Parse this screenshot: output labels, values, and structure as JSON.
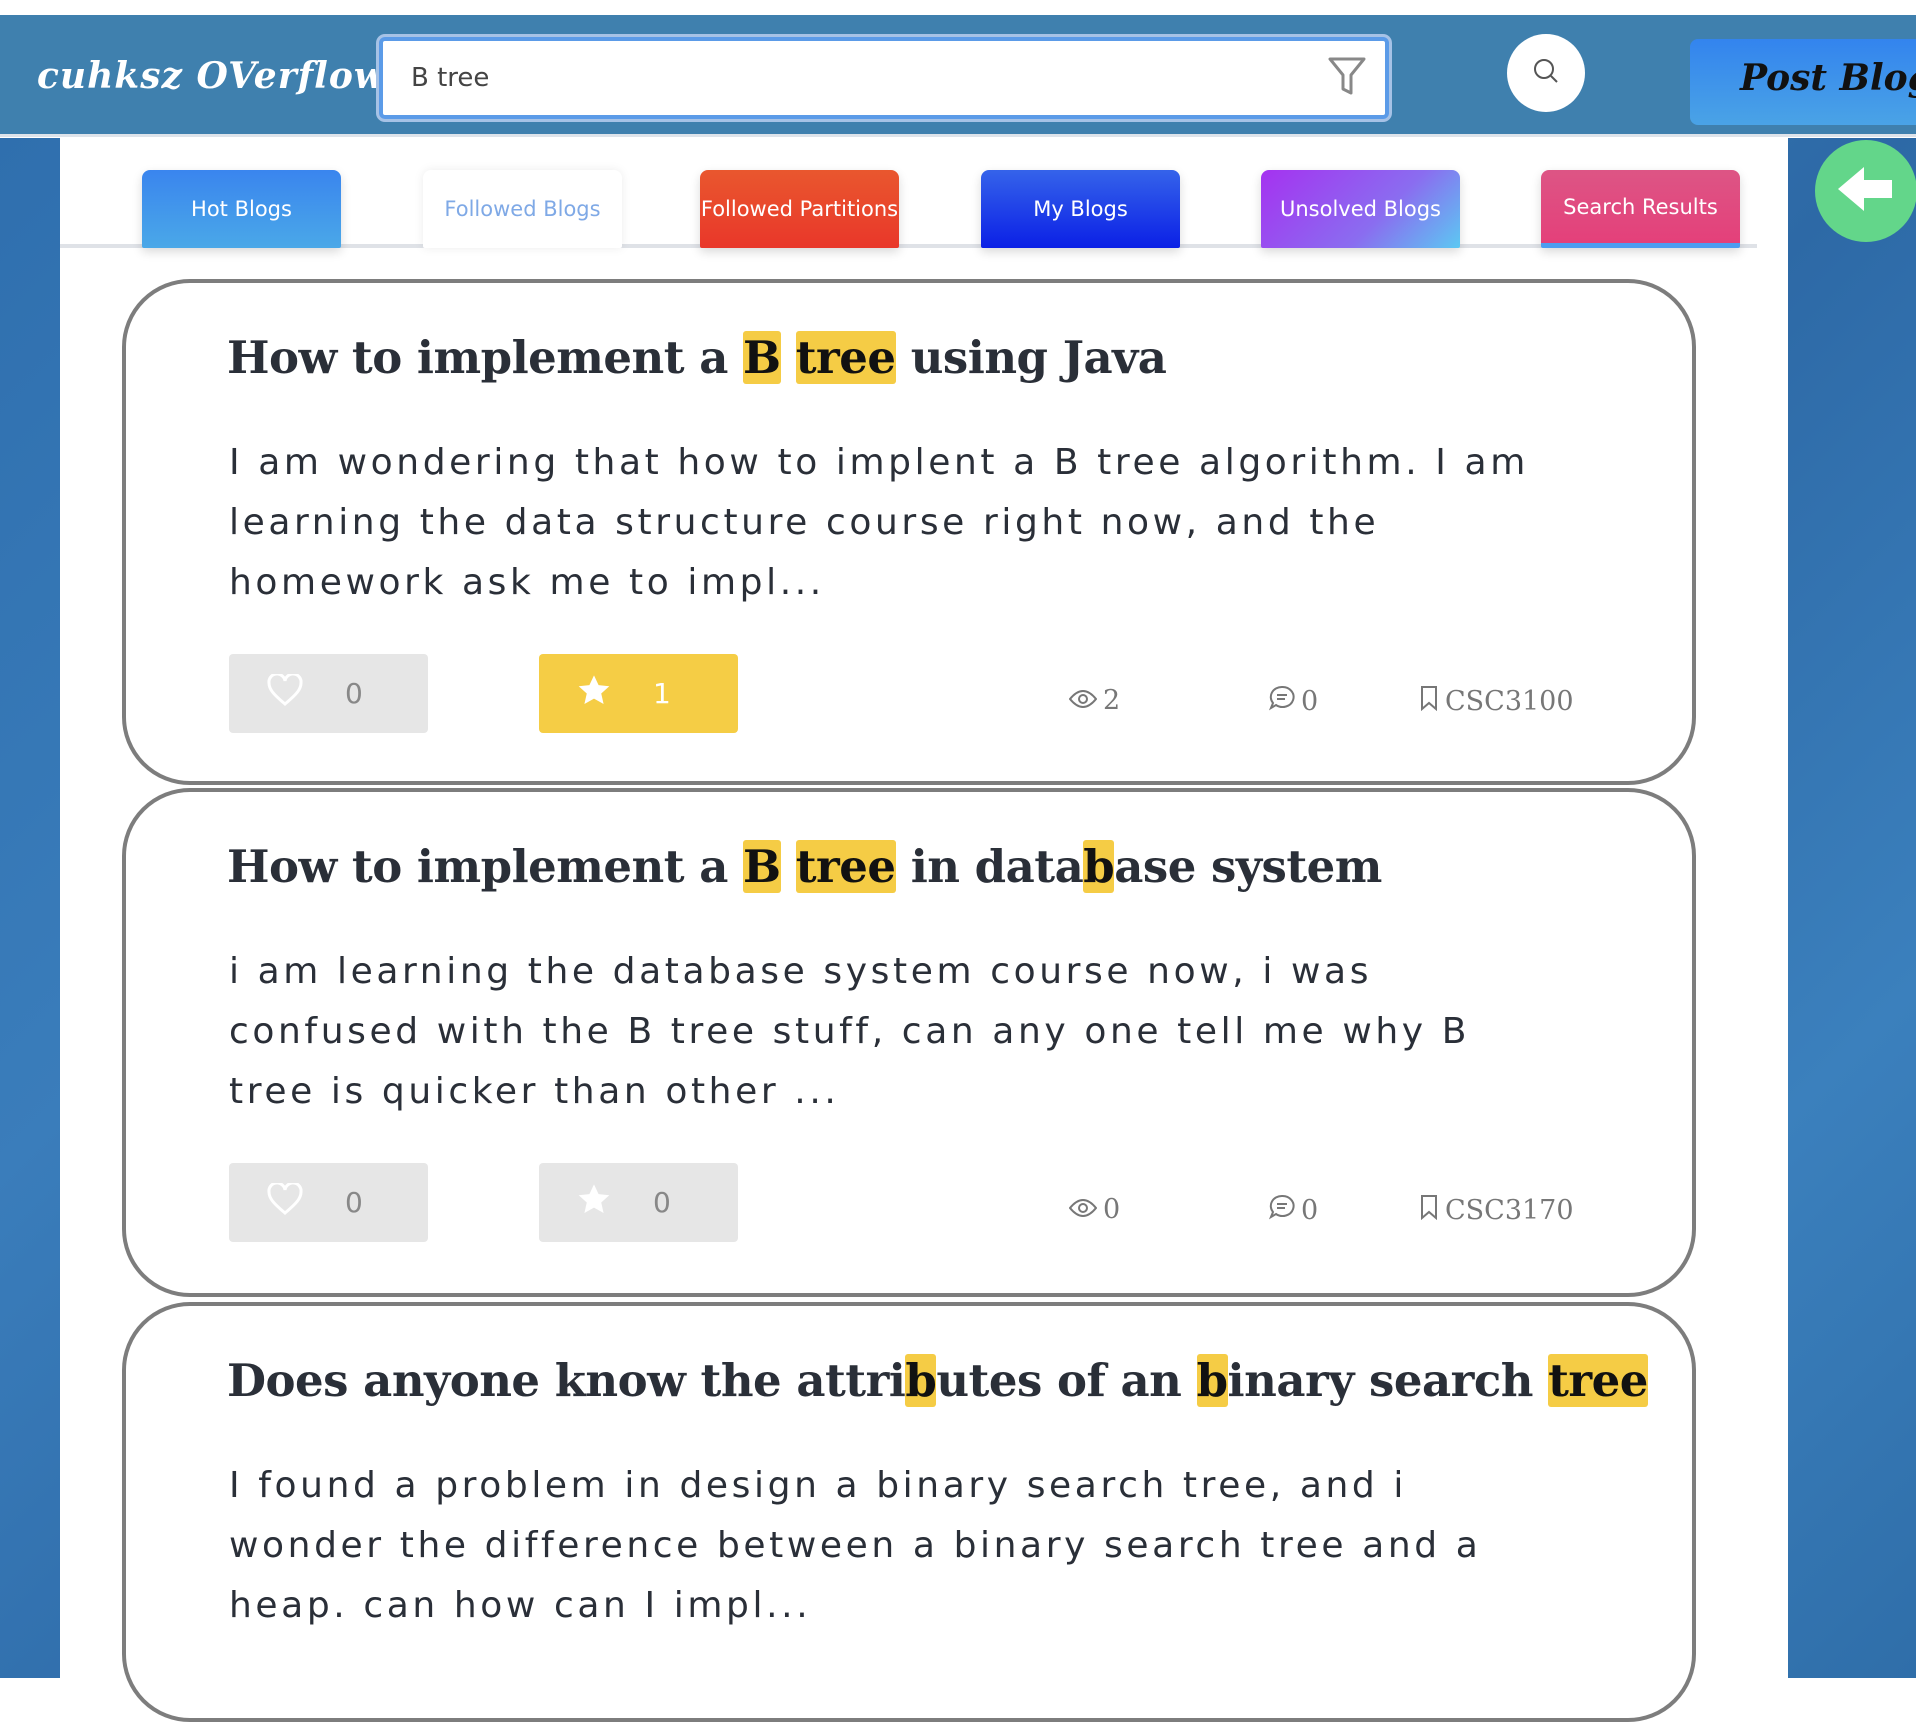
{
  "header": {
    "logo": "cuhksz OVerflow",
    "search_value": "B tree",
    "post_label": "Post Blog"
  },
  "tabs": [
    {
      "label": "Hot Blogs",
      "color": "#3f90ea"
    },
    {
      "label": "Followed Blogs",
      "color": "#ffffff"
    },
    {
      "label": "Followed Partitions",
      "color": "#e9452a"
    },
    {
      "label": "My Blogs",
      "color": "#1d3ee6"
    },
    {
      "label": "Unsolved Blogs",
      "color": "#9a4ef0"
    },
    {
      "label": "Search Results",
      "color": "#e2477c"
    }
  ],
  "cards": [
    {
      "title": [
        {
          "t": "How to implement a "
        },
        {
          "t": "B",
          "hl": true
        },
        {
          "t": " "
        },
        {
          "t": "tree",
          "hl": true
        },
        {
          "t": " using Java"
        }
      ],
      "body": "I am wondering that how to implent a B tree algorithm. I am learning the data structure course right now, and the homework ask me to impl...",
      "likes": "0",
      "stars": "1",
      "starred": true,
      "views": "2",
      "comments": "0",
      "tag": "CSC3100"
    },
    {
      "title": [
        {
          "t": "How to implement a "
        },
        {
          "t": "B",
          "hl": true
        },
        {
          "t": " "
        },
        {
          "t": "tree",
          "hl": true
        },
        {
          "t": " in data"
        },
        {
          "t": "b",
          "hl": true
        },
        {
          "t": "ase system"
        }
      ],
      "body": "i am learning the database system course now, i was confused with the B tree stuff, can any one tell me why B tree is quicker than other ...",
      "likes": "0",
      "stars": "0",
      "starred": false,
      "views": "0",
      "comments": "0",
      "tag": "CSC3170"
    },
    {
      "title": [
        {
          "t": "Does anyone know the attri"
        },
        {
          "t": "b",
          "hl": true
        },
        {
          "t": "utes of an "
        },
        {
          "t": "b",
          "hl": true
        },
        {
          "t": "inary search "
        },
        {
          "t": "tree",
          "hl": true
        }
      ],
      "body": "I found a problem in design a binary search tree, and i wonder the difference between a binary search tree and a heap. can how can I impl..."
    }
  ]
}
